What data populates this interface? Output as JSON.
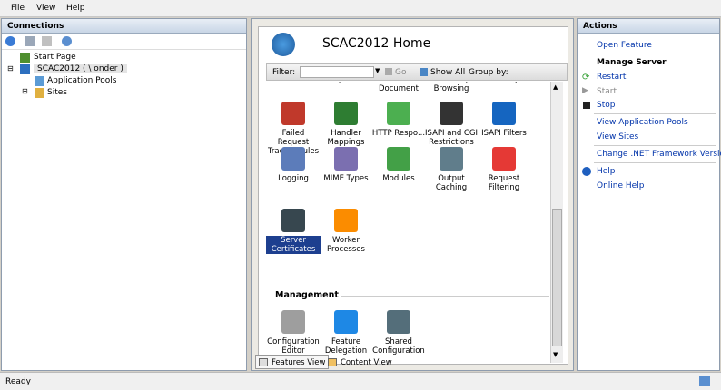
{
  "menu": [
    "File",
    "View",
    "Help"
  ],
  "connections": {
    "title": "Connections",
    "tree": {
      "start_page": "Start Page",
      "server": "SCAC2012 (   \\ onder   )",
      "app_pools": "Application Pools",
      "sites": "Sites"
    }
  },
  "center": {
    "title": "SCAC2012 Home",
    "filter_label": "Filter:",
    "go_label": "Go",
    "show_all_label": "Show All",
    "group_by_label": "Group by:",
    "partial_row": [
      "Authentication",
      "Compression",
      "Default Document",
      "Directory Browsing",
      "Error Pages"
    ],
    "features": [
      {
        "label": "Failed Request Tracing Rules",
        "icon": "failed-request-tracing-icon",
        "color": "#c0392b"
      },
      {
        "label": "Handler Mappings",
        "icon": "handler-mappings-icon",
        "color": "#2e7d32"
      },
      {
        "label": "HTTP Respo...",
        "icon": "http-response-icon",
        "color": "#4caf50"
      },
      {
        "label": "ISAPI and CGI Restrictions",
        "icon": "isapi-cgi-icon",
        "color": "#333333"
      },
      {
        "label": "ISAPI Filters",
        "icon": "isapi-filters-icon",
        "color": "#1565c0"
      },
      {
        "label": "Logging",
        "icon": "logging-icon",
        "color": "#5c7cba"
      },
      {
        "label": "MIME Types",
        "icon": "mime-types-icon",
        "color": "#7b6fb0"
      },
      {
        "label": "Modules",
        "icon": "modules-icon",
        "color": "#43a047"
      },
      {
        "label": "Output Caching",
        "icon": "output-caching-icon",
        "color": "#607d8b"
      },
      {
        "label": "Request Filtering",
        "icon": "request-filtering-icon",
        "color": "#e53935"
      },
      {
        "label": "Server Certificates",
        "icon": "server-certificates-icon",
        "color": "#37474f"
      },
      {
        "label": "Worker Processes",
        "icon": "worker-processes-icon",
        "color": "#fb8c00"
      }
    ],
    "management_label": "Management",
    "management": [
      {
        "label": "Configuration Editor",
        "icon": "configuration-editor-icon",
        "color": "#9e9e9e"
      },
      {
        "label": "Feature Delegation",
        "icon": "feature-delegation-icon",
        "color": "#1e88e5"
      },
      {
        "label": "Shared Configuration",
        "icon": "shared-configuration-icon",
        "color": "#546e7a"
      }
    ],
    "features_view": "Features View",
    "content_view": "Content View"
  },
  "actions": {
    "title": "Actions",
    "open_feature": "Open Feature",
    "manage_server": "Manage Server",
    "restart": "Restart",
    "start": "Start",
    "stop": "Stop",
    "view_app_pools": "View Application Pools",
    "view_sites": "View Sites",
    "change_net": "Change .NET Framework Version",
    "help": "Help",
    "online_help": "Online Help"
  },
  "status": "Ready",
  "colors": {
    "selection": "#1d3f8f",
    "link": "#0033aa"
  }
}
